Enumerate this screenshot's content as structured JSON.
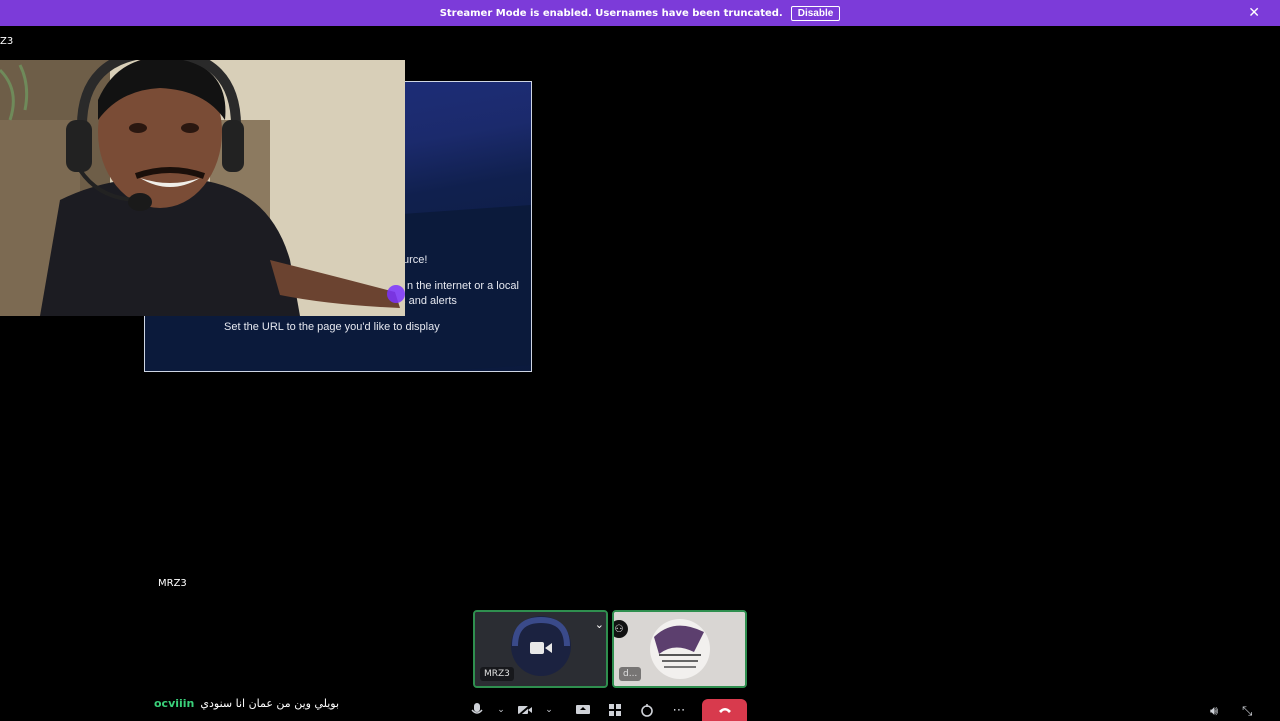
{
  "banner": {
    "text": "Streamer Mode is enabled. Usernames have been truncated.",
    "button": "Disable",
    "close": "✕"
  },
  "stream": {
    "name": "Z3"
  },
  "source": {
    "line1": "urce!",
    "line2": "n the internet or a local",
    "line3": "ts and alerts",
    "line4": "Set the URL to the page you'd like to display"
  },
  "user_label": "MRZ3",
  "tiles": [
    {
      "name": "MRZ3",
      "icon": "camera-icon"
    },
    {
      "name": "d..."
    }
  ],
  "chat": {
    "username": "ocviiin",
    "message": "بويلي وين من عمان انا سنودي"
  },
  "controls": [
    "microphone-icon",
    "camera-off-icon",
    "share-screen-icon",
    "activities-icon",
    "soundboard-icon",
    "more-icon",
    "leave-call-icon"
  ],
  "colors": {
    "banner": "#7c3bd9",
    "speaking_border": "#2f8f4f",
    "chat_username": "#3ad07a",
    "leave": "#d83a4d"
  }
}
